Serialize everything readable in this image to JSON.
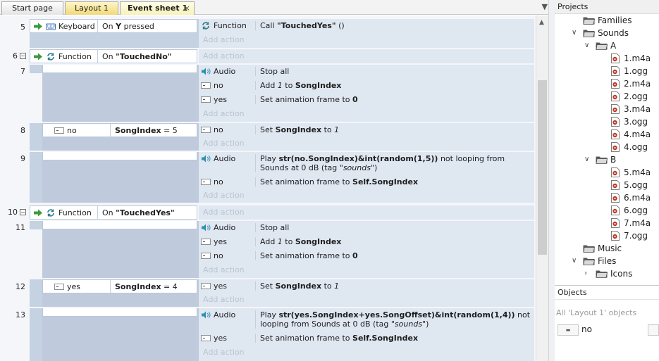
{
  "tabs": [
    {
      "label": "Start page"
    },
    {
      "label": "Layout 1"
    },
    {
      "label": "Event sheet 1",
      "close": "×"
    }
  ],
  "tab_menu": "▼",
  "events": {
    "e5": {
      "num": "5",
      "obj": "Keyboard",
      "cond_pre": "On ",
      "cond_key": "Y",
      "cond_post": " pressed",
      "a1_obj": "Function",
      "a1_pre": "Call ",
      "a1_bold": "\"TouchedYes\"",
      "a1_post": " ()",
      "add": "Add action"
    },
    "e6": {
      "num": "6",
      "obj": "Function",
      "cond_pre": "On ",
      "cond_bold": "\"TouchedNo\"",
      "add": "Add action"
    },
    "e7": {
      "num": "7",
      "a1_obj": "Audio",
      "a1": "Stop all",
      "a2_obj": "no",
      "a2_pre": "Add ",
      "a2_it": "1",
      "a2_mid": " to ",
      "a2_bold": "SongIndex",
      "a3_obj": "yes",
      "a3_pre": "Set animation frame to ",
      "a3_bold": "0",
      "add": "Add action"
    },
    "e8": {
      "num": "8",
      "obj": "no",
      "cond_bold": "SongIndex",
      "cond_post": " = 5",
      "a1_obj": "no",
      "a1_pre": "Set ",
      "a1_bold": "SongIndex",
      "a1_mid": " to ",
      "a1_it": "1",
      "add": "Add action"
    },
    "e9": {
      "num": "9",
      "a1_obj": "Audio",
      "a1_pre": "Play ",
      "a1_bold": "str(no.SongIndex)&int(random(1,5))",
      "a1_post": " not looping from Sounds at 0 dB (tag ",
      "a1_it": "\"sounds\"",
      "a1_end": ")",
      "a2_obj": "no",
      "a2_pre": "Set animation frame to ",
      "a2_bold": "Self.SongIndex",
      "add": "Add action"
    },
    "e10": {
      "num": "10",
      "obj": "Function",
      "cond_pre": "On ",
      "cond_bold": "\"TouchedYes\"",
      "add": "Add action"
    },
    "e11": {
      "num": "11",
      "a1_obj": "Audio",
      "a1": "Stop all",
      "a2_obj": "yes",
      "a2_pre": "Add ",
      "a2_it": "1",
      "a2_mid": " to ",
      "a2_bold": "SongIndex",
      "a3_obj": "no",
      "a3_pre": "Set animation frame to ",
      "a3_bold": "0",
      "add": "Add action"
    },
    "e12": {
      "num": "12",
      "obj": "yes",
      "cond_bold": "SongIndex",
      "cond_post": " = 4",
      "a1_obj": "yes",
      "a1_pre": "Set ",
      "a1_bold": "SongIndex",
      "a1_mid": " to ",
      "a1_it": "1",
      "add": "Add action"
    },
    "e13": {
      "num": "13",
      "a1_obj": "Audio",
      "a1_pre": "Play ",
      "a1_bold": "str(yes.SongIndex+yes.SongOffset)&int(random(1,4))",
      "a1_post": " not looping from Sounds at 0 dB (tag ",
      "a1_it": "\"sounds\"",
      "a1_end": ")",
      "a2_obj": "yes",
      "a2_pre": "Set animation frame to ",
      "a2_bold": "Self.SongIndex",
      "add": "Add action"
    }
  },
  "projects": {
    "title": "Projects",
    "families": "Families",
    "sounds": "Sounds",
    "folder_a": "A",
    "files_a": [
      "1.m4a",
      "1.ogg",
      "2.m4a",
      "2.ogg",
      "3.m4a",
      "3.ogg",
      "4.m4a",
      "4.ogg"
    ],
    "folder_b": "B",
    "files_b": [
      "5.m4a",
      "5.ogg",
      "6.m4a",
      "6.ogg",
      "7.m4a",
      "7.ogg"
    ],
    "music": "Music",
    "files": "Files",
    "icons": "Icons"
  },
  "objects": {
    "title": "Objects",
    "subtitle": "All 'Layout 1' objects",
    "item": "no"
  },
  "colors": {
    "accent": "#3b6fb6",
    "condition_band": "#c4d2e2",
    "action_band": "#dfe7f1",
    "add_action": "#b9c4d0"
  }
}
